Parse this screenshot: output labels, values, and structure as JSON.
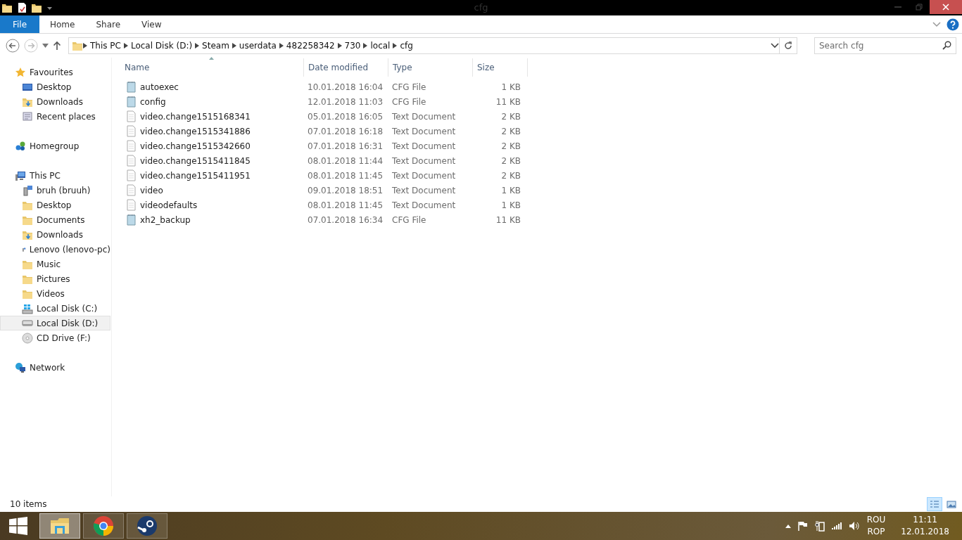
{
  "window": {
    "title": "cfg"
  },
  "ribbon_tabs": [
    {
      "label": "File",
      "kind": "file",
      "selected": false
    },
    {
      "label": "Home",
      "kind": "tab",
      "selected": false
    },
    {
      "label": "Share",
      "kind": "tab",
      "selected": false
    },
    {
      "label": "View",
      "kind": "tab",
      "selected": false
    }
  ],
  "address": {
    "crumbs": [
      "This PC",
      "Local Disk (D:)",
      "Steam",
      "userdata",
      "482258342",
      "730",
      "local",
      "cfg"
    ]
  },
  "search": {
    "placeholder": "Search cfg"
  },
  "sidebar": {
    "groups": [
      {
        "label": "Favourites",
        "kind": "star",
        "children": [
          {
            "label": "Desktop",
            "kind": "desktop",
            "selected": false
          },
          {
            "label": "Downloads",
            "kind": "downloads",
            "selected": false
          },
          {
            "label": "Recent places",
            "kind": "recent",
            "selected": false
          }
        ]
      },
      {
        "label": "Homegroup",
        "kind": "homegroup"
      },
      {
        "label": "This PC",
        "kind": "pc",
        "children": [
          {
            "label": "bruh (bruuh)",
            "kind": "netpc",
            "selected": false
          },
          {
            "label": "Desktop",
            "kind": "folder",
            "selected": false
          },
          {
            "label": "Documents",
            "kind": "folder",
            "selected": false
          },
          {
            "label": "Downloads",
            "kind": "downloads",
            "selected": false
          },
          {
            "label": "Lenovo (lenovo-pc)",
            "kind": "netpc",
            "selected": false
          },
          {
            "label": "Music",
            "kind": "folder",
            "selected": false
          },
          {
            "label": "Pictures",
            "kind": "folder",
            "selected": false
          },
          {
            "label": "Videos",
            "kind": "folder",
            "selected": false
          },
          {
            "label": "Local Disk (C:)",
            "kind": "sysdisk",
            "selected": false
          },
          {
            "label": "Local Disk (D:)",
            "kind": "disk",
            "selected": true
          },
          {
            "label": "CD Drive (F:)",
            "kind": "cd",
            "selected": false
          }
        ]
      },
      {
        "label": "Network",
        "kind": "network"
      }
    ]
  },
  "table": {
    "columns": [
      {
        "label": "Name",
        "sorted": true
      },
      {
        "label": "Date modified",
        "sorted": false
      },
      {
        "label": "Type",
        "sorted": false
      },
      {
        "label": "Size",
        "sorted": false
      }
    ],
    "rows": [
      {
        "name": "autoexec",
        "date": "10.01.2018 16:04",
        "type": "CFG File",
        "size": "1 KB",
        "kind": "cfg"
      },
      {
        "name": "config",
        "date": "12.01.2018 11:03",
        "type": "CFG File",
        "size": "11 KB",
        "kind": "cfg"
      },
      {
        "name": "video.change1515168341",
        "date": "05.01.2018 16:05",
        "type": "Text Document",
        "size": "2 KB",
        "kind": "text"
      },
      {
        "name": "video.change1515341886",
        "date": "07.01.2018 16:18",
        "type": "Text Document",
        "size": "2 KB",
        "kind": "text"
      },
      {
        "name": "video.change1515342660",
        "date": "07.01.2018 16:31",
        "type": "Text Document",
        "size": "2 KB",
        "kind": "text"
      },
      {
        "name": "video.change1515411845",
        "date": "08.01.2018 11:44",
        "type": "Text Document",
        "size": "2 KB",
        "kind": "text"
      },
      {
        "name": "video.change1515411951",
        "date": "08.01.2018 11:45",
        "type": "Text Document",
        "size": "2 KB",
        "kind": "text"
      },
      {
        "name": "video",
        "date": "09.01.2018 18:51",
        "type": "Text Document",
        "size": "1 KB",
        "kind": "text"
      },
      {
        "name": "videodefaults",
        "date": "08.01.2018 11:45",
        "type": "Text Document",
        "size": "1 KB",
        "kind": "text"
      },
      {
        "name": "xh2_backup",
        "date": "07.01.2018 16:34",
        "type": "CFG File",
        "size": "11 KB",
        "kind": "cfg"
      }
    ]
  },
  "status_bar": {
    "items": "10 items",
    "views": [
      {
        "kind": "details",
        "selected": true
      },
      {
        "kind": "large",
        "selected": false
      }
    ]
  },
  "taskbar": {
    "apps": [
      {
        "kind": "explorer",
        "selected": true
      },
      {
        "kind": "chrome",
        "selected": false
      },
      {
        "kind": "steam",
        "selected": false
      }
    ],
    "language": [
      "ROU",
      "ROP"
    ],
    "time": "11:11",
    "date": "12.01.2018"
  }
}
